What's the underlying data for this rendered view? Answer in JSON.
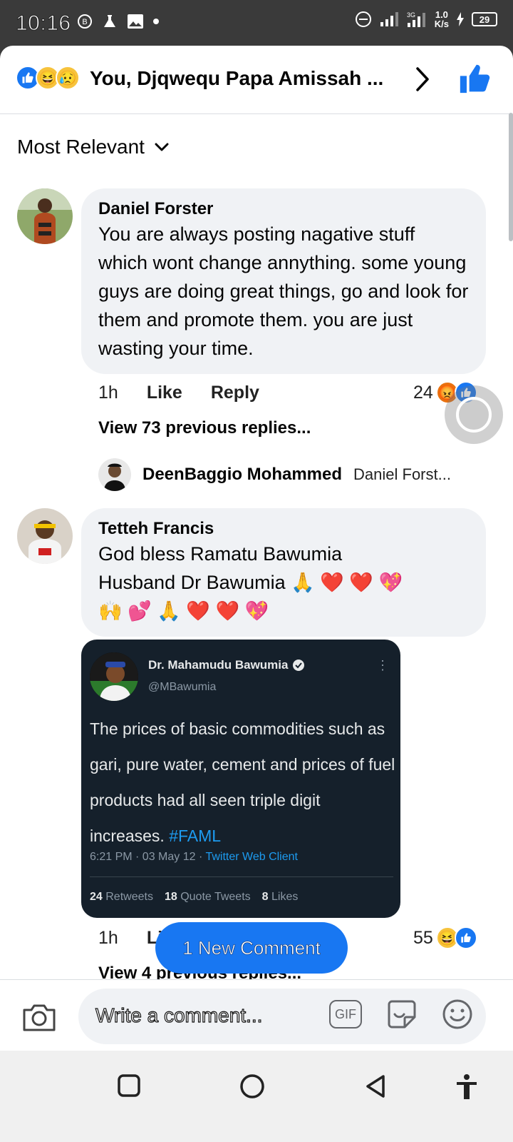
{
  "status_bar": {
    "time": "10:16",
    "network_speed_value": "1.0",
    "network_speed_unit": "K/s",
    "battery": "29",
    "network_type": "3G"
  },
  "header": {
    "reactions": [
      "like",
      "haha",
      "sad"
    ],
    "title": "You, Djqwequ Papa Amissah ..."
  },
  "sort": {
    "label": "Most Relevant"
  },
  "comments": [
    {
      "author": "Daniel Forster",
      "text": "You are always posting nagative stuff which wont change annything. some young guys are doing great things, go and look for them and promote them. you are just wasting your time.",
      "time": "1h",
      "like_label": "Like",
      "reply_label": "Reply",
      "reaction_count": "24",
      "reactions": [
        "angry",
        "like"
      ],
      "view_previous": "View 73 previous replies...",
      "latest_reply": {
        "author": "DeenBaggio Mohammed",
        "preview": "Daniel Forst..."
      }
    },
    {
      "author": "Tetteh Francis",
      "text_line1": "God bless Ramatu Bawumia",
      "text_line2": "Husband Dr Bawumia 🙏 ❤️ ❤️ 💖",
      "text_line3": "🙌 💕 🙏 ❤️ ❤️ 💖",
      "time": "1h",
      "like_label": "Li",
      "reaction_count": "55",
      "reactions": [
        "haha",
        "like"
      ],
      "view_previous": "View 4 previous replies..."
    }
  ],
  "tweet": {
    "name": "Dr. Mahamudu Bawumia",
    "handle": "@MBawumia",
    "text": "The prices of basic commodities such as gari, pure water, cement and prices of fuel products had all seen triple digit increases.",
    "hashtag": "#FAML",
    "timestamp": "6:21 PM · 03 May 12 · ",
    "client": "Twitter Web Client",
    "retweets": "24",
    "retweets_label": "Retweets",
    "quotes": "18",
    "quotes_label": "Quote Tweets",
    "likes": "8",
    "likes_label": "Likes"
  },
  "new_comment_pill": "1 New Comment",
  "composer": {
    "placeholder": "Write a comment...",
    "gif_label": "GIF"
  },
  "colors": {
    "facebook_blue": "#1877f2",
    "bubble_gray": "#f0f2f5",
    "twitter_dark": "#15202b",
    "twitter_blue": "#1d9bf0"
  },
  "icons": [
    "camera-icon",
    "gif-icon",
    "sticker-icon",
    "emoji-icon",
    "like-thumb-icon",
    "chevron-right-icon",
    "chevron-down-icon",
    "verified-icon"
  ]
}
